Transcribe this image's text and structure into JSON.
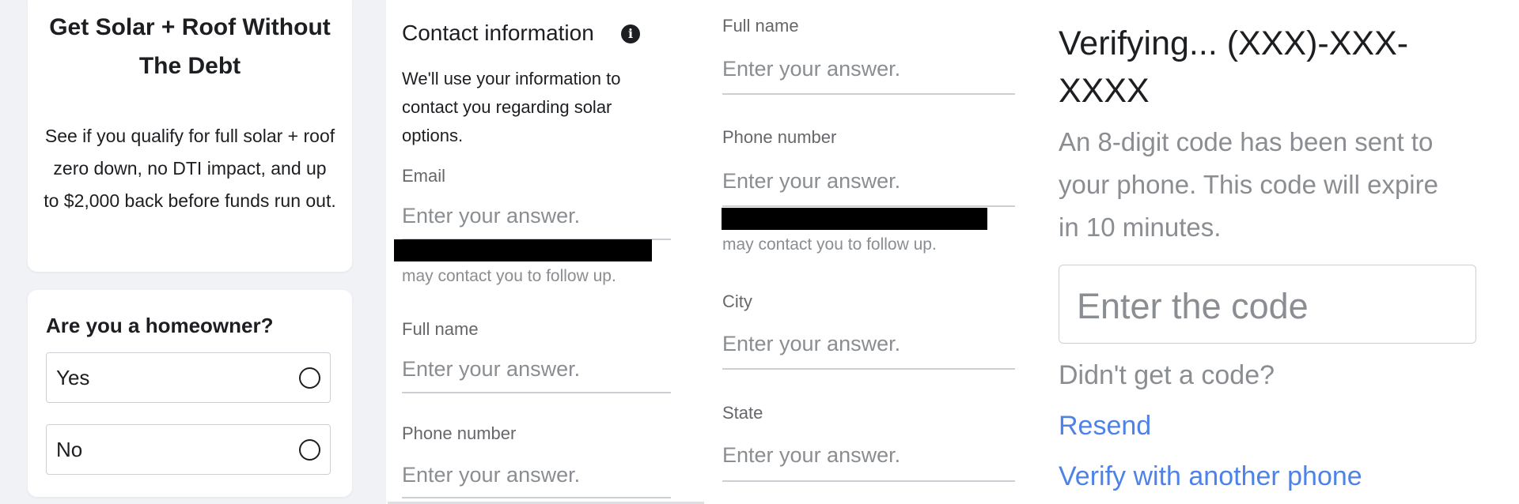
{
  "panel1": {
    "card_title": "Get Solar + Roof Without The Debt",
    "card_body": "See if you qualify for full solar + roof zero down, no DTI impact, and up to $2,000 back before funds run out.",
    "question": "Are you a homeowner?",
    "options": [
      {
        "label": "Yes"
      },
      {
        "label": "No"
      }
    ]
  },
  "panel2": {
    "title": "Contact information",
    "info_icon": "info-icon",
    "description": "We'll use your information to contact you regarding solar options.",
    "email": {
      "label": "Email",
      "placeholder": "Enter your answer."
    },
    "follow_up_note": "may contact you to follow up.",
    "full_name": {
      "label": "Full name",
      "placeholder": "Enter your answer."
    },
    "phone": {
      "label": "Phone number",
      "placeholder": "Enter your answer."
    }
  },
  "panel3": {
    "full_name": {
      "label": "Full name",
      "placeholder": "Enter your answer."
    },
    "phone": {
      "label": "Phone number",
      "placeholder": "Enter your answer."
    },
    "follow_up_note": "may contact you to follow up.",
    "city": {
      "label": "City",
      "placeholder": "Enter your answer."
    },
    "state": {
      "label": "State",
      "placeholder": "Enter your answer."
    }
  },
  "panel4": {
    "title": "Verifying... (XXX)-XXX-XXXX",
    "description": "An 8-digit code has been sent to your phone. This code will expire in 10 minutes.",
    "code_placeholder": "Enter the code",
    "no_code": "Didn't get a code?",
    "resend": "Resend",
    "verify_other": "Verify with another phone"
  },
  "colors": {
    "link": "#4d83e8",
    "text": "#1c1e21",
    "muted": "#8a8d91",
    "page_bg": "#f0f2f5"
  }
}
